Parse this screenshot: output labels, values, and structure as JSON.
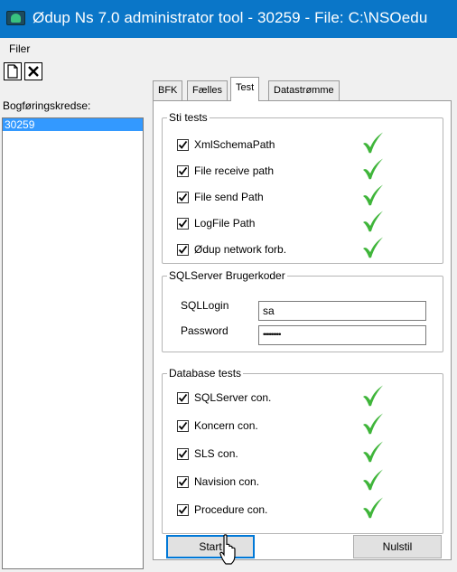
{
  "window": {
    "title": "Ødup Ns 7.0 administrator tool - 30259 - File: C:\\NSOedu"
  },
  "menu": {
    "items": [
      {
        "label": "Filer"
      }
    ]
  },
  "toolbar": {
    "new_icon": "new-document-icon",
    "delete_icon": "delete-x-icon"
  },
  "left": {
    "label": "Bogføringskredse:",
    "items": [
      {
        "label": "30259",
        "selected": true
      }
    ]
  },
  "tabs": [
    {
      "label": "BFK",
      "active": false
    },
    {
      "label": "Fælles",
      "active": false
    },
    {
      "label": "Test",
      "active": true
    },
    {
      "label": "Datastrømme",
      "active": false
    }
  ],
  "sti_tests": {
    "legend": "Sti tests",
    "items": [
      {
        "label": "XmlSchemaPath",
        "checked": true,
        "status": "ok"
      },
      {
        "label": "File receive path",
        "checked": true,
        "status": "ok"
      },
      {
        "label": "File send Path",
        "checked": true,
        "status": "ok"
      },
      {
        "label": "LogFile Path",
        "checked": true,
        "status": "ok"
      },
      {
        "label": "Ødup network forb.",
        "checked": true,
        "status": "ok"
      }
    ]
  },
  "sql": {
    "legend": "SQLServer Brugerkoder",
    "login_label": "SQLLogin",
    "login_value": "sa",
    "password_label": "Password",
    "password_value": "•••••••••"
  },
  "db_tests": {
    "legend": "Database tests",
    "items": [
      {
        "label": "SQLServer con.",
        "checked": true,
        "status": "ok"
      },
      {
        "label": "Koncern con.",
        "checked": true,
        "status": "ok"
      },
      {
        "label": "SLS con.",
        "checked": true,
        "status": "ok"
      },
      {
        "label": "Navision con.",
        "checked": true,
        "status": "ok"
      },
      {
        "label": "Procedure con.",
        "checked": true,
        "status": "ok"
      }
    ]
  },
  "buttons": {
    "start": "Start",
    "reset": "Nulstil"
  },
  "colors": {
    "titlebar": "#0a76c8",
    "selection": "#3399ff",
    "ok_check": "#3fb53a"
  }
}
